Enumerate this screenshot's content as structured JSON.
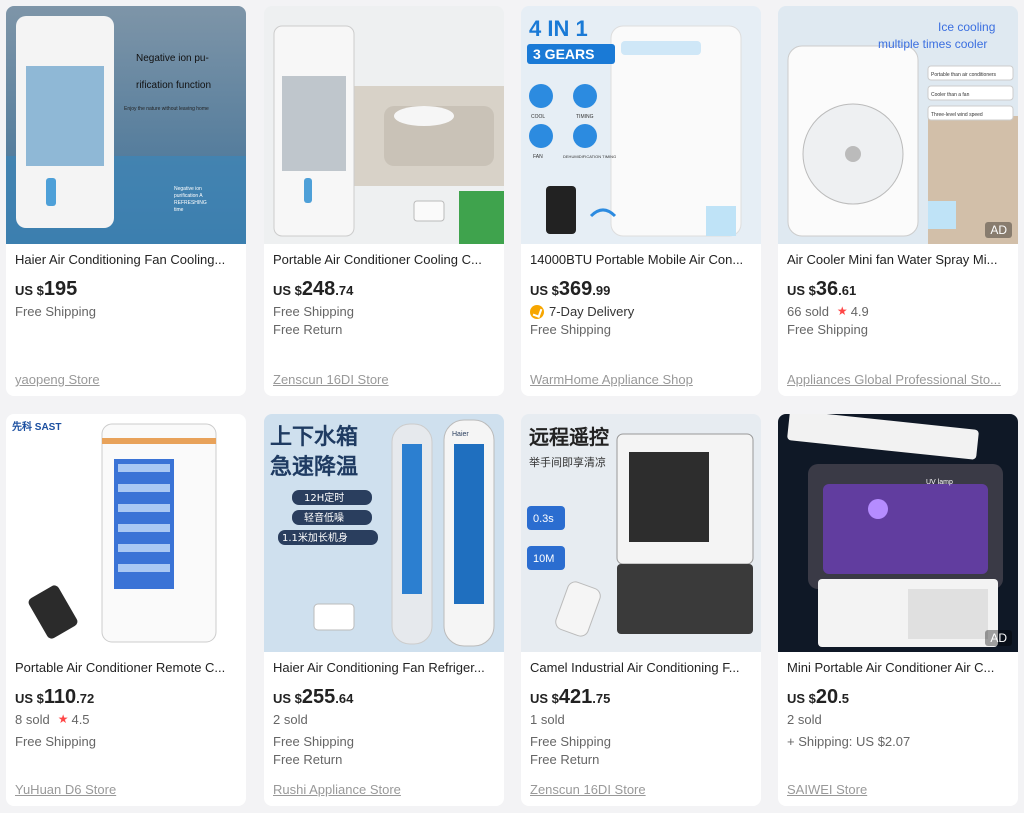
{
  "products": [
    {
      "title": "Haier Air Conditioning Fan Cooling...",
      "price_currency": "US $",
      "price_int": "195",
      "price_dec": "",
      "delivery": "",
      "sold": "",
      "rating": "",
      "shipping": "Free Shipping",
      "returns": "",
      "store": "yaopeng Store",
      "ad": "",
      "image_text": [
        "Negative ion pu-",
        "rification function",
        "Enjoy the nature without leaving home",
        "Negative ion",
        "purification A",
        "REFRESHING",
        "time"
      ]
    },
    {
      "title": "Portable Air Conditioner Cooling C...",
      "price_currency": "US $",
      "price_int": "248",
      "price_dec": ".74",
      "delivery": "",
      "sold": "",
      "rating": "",
      "shipping": "Free Shipping",
      "returns": "Free Return",
      "store": "Zenscun 16DI Store",
      "ad": "",
      "image_text": []
    },
    {
      "title": "14000BTU Portable Mobile Air Con...",
      "price_currency": "US $",
      "price_int": "369",
      "price_dec": ".99",
      "delivery": "7-Day Delivery",
      "sold": "",
      "rating": "",
      "shipping": "Free Shipping",
      "returns": "",
      "store": "WarmHome Appliance Shop",
      "ad": "",
      "image_text": [
        "4 IN 1",
        "3 GEARS",
        "COOL",
        "TIMING",
        "FAN",
        "DEHUMIDIFICATION TIMING"
      ]
    },
    {
      "title": "Air Cooler Mini fan Water Spray Mi...",
      "price_currency": "US $",
      "price_int": "36",
      "price_dec": ".61",
      "delivery": "",
      "sold": "66 sold",
      "rating": "4.9",
      "shipping": "Free Shipping",
      "returns": "",
      "store": "Appliances Global Professional Sto...",
      "ad": "AD",
      "image_text": [
        "Ice cooling",
        "multiple times cooler",
        "Portable than air conditioners",
        "Cooler than a fan",
        "Three-level wind speed"
      ]
    },
    {
      "title": "Portable Air Conditioner Remote C...",
      "price_currency": "US $",
      "price_int": "110",
      "price_dec": ".72",
      "delivery": "",
      "sold": "8 sold",
      "rating": "4.5",
      "shipping": "Free Shipping",
      "returns": "",
      "store": "YuHuan D6 Store",
      "ad": "",
      "image_text": [
        "先科 SAST"
      ]
    },
    {
      "title": "Haier Air Conditioning Fan Refriger...",
      "price_currency": "US $",
      "price_int": "255",
      "price_dec": ".64",
      "delivery": "",
      "sold": "2 sold",
      "rating": "",
      "shipping": "Free Shipping",
      "returns": "Free Return",
      "store": "Rushi Appliance Store",
      "ad": "",
      "image_text": [
        "上下水箱",
        "急速降温",
        "12H定时",
        "轻音低噪",
        "1.1米加长机身",
        "Haier"
      ]
    },
    {
      "title": "Camel Industrial Air Conditioning F...",
      "price_currency": "US $",
      "price_int": "421",
      "price_dec": ".75",
      "delivery": "",
      "sold": "1 sold",
      "rating": "",
      "shipping": "Free Shipping",
      "returns": "Free Return",
      "store": "Zenscun 16DI Store",
      "ad": "",
      "image_text": [
        "远程遥控",
        "举手间即享清凉",
        "0.3s",
        "10M"
      ]
    },
    {
      "title": "Mini Portable Air Conditioner Air C...",
      "price_currency": "US $",
      "price_int": "20",
      "price_dec": ".5",
      "delivery": "",
      "sold": "2 sold",
      "rating": "",
      "shipping": "+ Shipping: US $2.07",
      "returns": "",
      "store": "SAIWEI Store",
      "ad": "AD",
      "image_text": [
        "UV lamp"
      ]
    }
  ],
  "colors": {
    "page_bg": "#f3f3f5",
    "card_bg": "#ffffff",
    "price": "#222222",
    "muted": "#666666",
    "store": "#999999",
    "star": "#ff4747",
    "delivery_icon": "#f7a600"
  },
  "icons": {
    "rating": "star-icon",
    "delivery": "delivery-truck-icon"
  }
}
